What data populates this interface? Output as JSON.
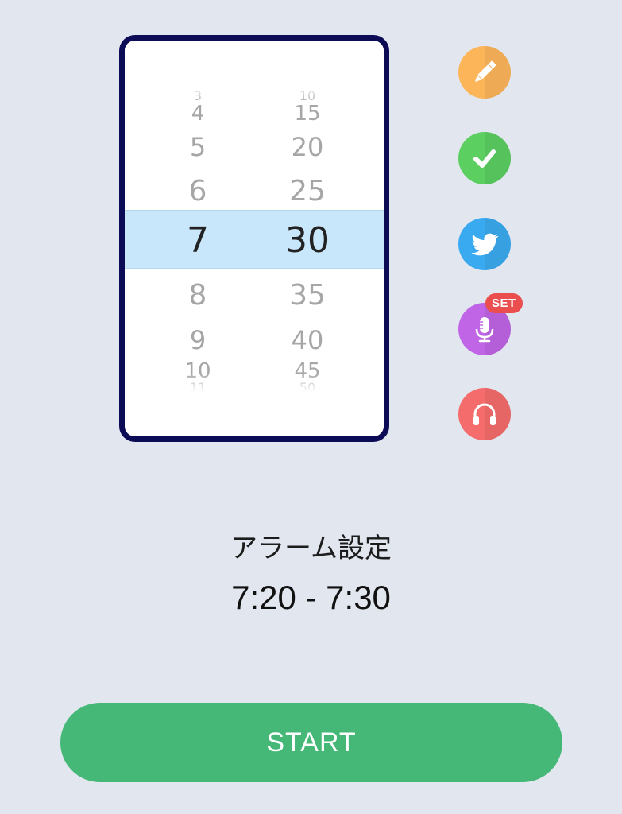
{
  "picker": {
    "hours": [
      "3",
      "4",
      "5",
      "6",
      "7",
      "8",
      "9",
      "10",
      "11"
    ],
    "minutes": [
      "10",
      "15",
      "20",
      "25",
      "30",
      "35",
      "40",
      "45",
      "50"
    ],
    "selected_hour": "7",
    "selected_minute": "30"
  },
  "actions": [
    {
      "name": "edit-button",
      "icon": "pencil-icon",
      "color": "#fdb55a"
    },
    {
      "name": "check-button",
      "icon": "check-icon",
      "color": "#5ccf61"
    },
    {
      "name": "twitter-button",
      "icon": "twitter-bird-icon",
      "color": "#3aaaf0"
    },
    {
      "name": "voice-button",
      "icon": "microphone-icon",
      "color": "#c065e6"
    },
    {
      "name": "sound-button",
      "icon": "headphones-icon",
      "color": "#f56c6c"
    }
  ],
  "voice_badge": "SET",
  "alarm": {
    "title": "アラーム設定",
    "range": "7:20 - 7:30"
  },
  "start_label": "START",
  "colors": {
    "background": "#e1e6ef",
    "picker_border": "#0c0b55",
    "selection_band": "#c9e7fb",
    "start_button": "#45b878"
  }
}
